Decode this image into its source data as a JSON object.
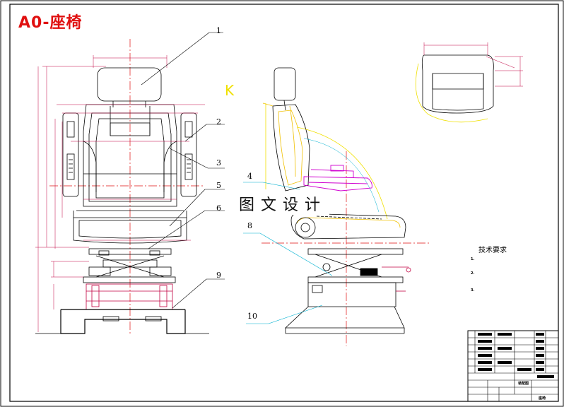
{
  "drawing": {
    "title": "A0-座椅",
    "watermark": "图文设计"
  },
  "callouts": [
    {
      "id": "1",
      "label": "1"
    },
    {
      "id": "2",
      "label": "2"
    },
    {
      "id": "3",
      "label": "3"
    },
    {
      "id": "4",
      "label": "4"
    },
    {
      "id": "5",
      "label": "5"
    },
    {
      "id": "6",
      "label": "6"
    },
    {
      "id": "8",
      "label": "8"
    },
    {
      "id": "9",
      "label": "9"
    },
    {
      "id": "10",
      "label": "10"
    }
  ],
  "side_view_mark": "K",
  "tech_requirements": {
    "title": "技术要求",
    "notes": [
      "1.",
      "2.",
      "3."
    ]
  },
  "title_block": {
    "label_a": "装配图",
    "label_b": "座椅"
  },
  "colors": {
    "outline": "#000000",
    "centerline": "#e01010",
    "dimension": "#c00040",
    "magenta_part": "#d000d0",
    "yellow_construction": "#f0e000",
    "cyan_leader": "#00b0d0",
    "title_red": "#e01010"
  }
}
